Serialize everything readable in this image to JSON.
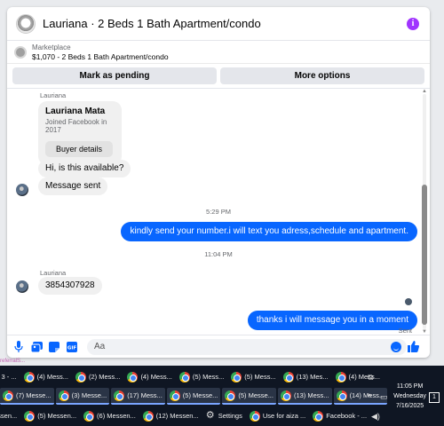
{
  "window": {
    "title": "Lauriana · 2 Beds 1 Bath Apartment/condo",
    "info_glyph": "i"
  },
  "marketplace": {
    "label": "Marketplace",
    "listing": "$1,070 - 2 Beds 1 Bath Apartment/condo"
  },
  "actions": {
    "pending": "Mark as pending",
    "more": "More options"
  },
  "messages": {
    "sender_1": "Lauriana",
    "card_name": "Lauriana Mata",
    "card_sub": "Joined Facebook in 2017",
    "card_button": "Buyer details",
    "msg_available": "Hi, is this available?",
    "msg_sent_auto": "Message sent",
    "ts_1": "5:29 PM",
    "msg_out_1": "kindly send your number.i will text you adress,schedule and apartment.",
    "ts_2": "11:04 PM",
    "sender_2": "Lauriana",
    "msg_number": "3854307928",
    "msg_out_2": "thanks i will message you in a moment",
    "status": "Sent"
  },
  "composer": {
    "placeholder": "Aa"
  },
  "link_strip": "referralS...",
  "taskbar": {
    "row1": [
      "ork 3 - ...",
      "(4) Mess...",
      "(2) Mess...",
      "(4) Mess...",
      "(5) Mess...",
      "(5) Mess...",
      "(13) Mes...",
      "(4) Mess..."
    ],
    "row2": [
      "(7) Messe...",
      "(3) Messe...",
      "(17) Mess...",
      "(5) Messe...",
      "(5) Messe...",
      "(13) Mess...",
      "(14) Mess..."
    ],
    "row3": [
      "essen...",
      "(5) Messen...",
      "(6) Messen...",
      "(12) Messen...",
      "Settings",
      "Use for aiza ...",
      "Facebook - ..."
    ],
    "time": "11:05 PM",
    "day": "Wednesday",
    "date": "7/16/2025",
    "notif_count": "1"
  },
  "colors": {
    "accent": "#0866ff",
    "info": "#a033ff",
    "taskbar": "#0f1623"
  }
}
